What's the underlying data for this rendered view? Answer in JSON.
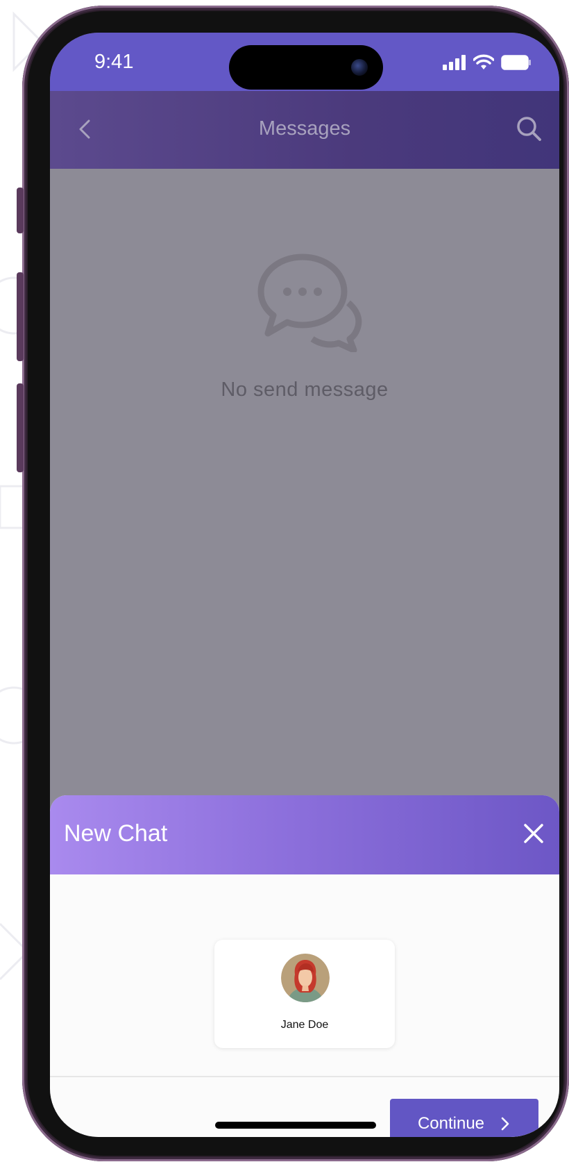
{
  "status_bar": {
    "time": "9:41",
    "icons": [
      "signal-icon",
      "wifi-icon",
      "battery-icon"
    ]
  },
  "header": {
    "title": "Messages",
    "back_icon": "chevron-left-icon",
    "search_icon": "search-icon"
  },
  "empty_state": {
    "icon": "chat-bubbles-icon",
    "text": "No send message"
  },
  "new_chat_sheet": {
    "title": "New Chat",
    "close_icon": "close-icon",
    "contacts": [
      {
        "name": "Jane Doe",
        "avatar": "avatar-icon"
      }
    ],
    "continue_label": "Continue"
  },
  "colors": {
    "status_bar": "#6358c6",
    "app_bar": "#4b3a7c",
    "overlay": "#8d8b96",
    "sheet_header_start": "#a98aee",
    "sheet_header_end": "#6d57c6",
    "primary_button": "#6256c4"
  }
}
